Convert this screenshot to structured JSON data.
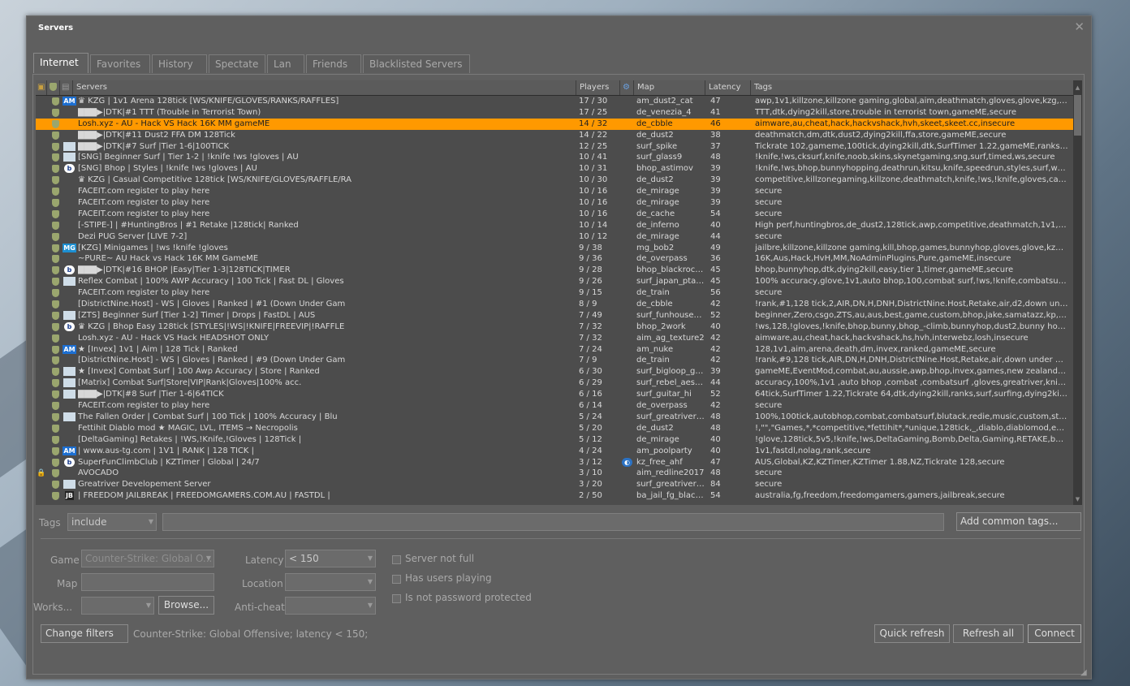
{
  "window": {
    "title": "Servers",
    "close_glyph": "✕"
  },
  "tabs": [
    "Internet",
    "Favorites",
    "History",
    "Spectate",
    "Lan",
    "Friends",
    "Blacklisted Servers"
  ],
  "columns": {
    "servers": "Servers",
    "players": "Players",
    "map": "Map",
    "latency": "Latency",
    "tags": "Tags"
  },
  "servers": [
    {
      "lock": "",
      "badge": "AM",
      "name": "♛ KZG | 1v1 Arena 128tick [WS/KNIFE/GLOVES/RANKS/RAFFLES]",
      "players": "17 / 30",
      "bot": "",
      "map": "am_dust2_cat",
      "latency": "47",
      "tags": "awp,1v1,killzone,killzone gaming,global,aim,deathmatch,gloves,glove,kzg,gungame,!..."
    },
    {
      "lock": "",
      "badge": "",
      "name": "▇▇▇▶|DTK|#1 TTT (Trouble in Terrorist Town)",
      "players": "17 / 25",
      "bot": "",
      "map": "de_venezia_4",
      "latency": "41",
      "tags": "TTT,dtk,dying2kill,store,trouble in terrorist town,gameME,secure"
    },
    {
      "lock": "",
      "badge": "",
      "name": "Losh.xyz - AU - Hack VS Hack 16K MM gameME",
      "players": "14 / 32",
      "bot": "",
      "map": "de_cbble",
      "latency": "46",
      "tags": "aimware,au,cheat,hack,hackvshack,hvh,skeet,skeet.cc,insecure",
      "selected": true
    },
    {
      "lock": "",
      "badge": "",
      "name": "▇▇▇▶|DTK|#11 Dust2 FFA DM 128Tick",
      "players": "14 / 22",
      "bot": "",
      "map": "de_dust2",
      "latency": "38",
      "tags": "deathmatch,dm,dtk,dust2,dying2kill,ffa,store,gameME,secure"
    },
    {
      "lock": "",
      "badge": "SQ",
      "name": "▇▇▇▶|DTK|#7 Surf |Tier 1-6|100TICK",
      "players": "12 / 25",
      "bot": "",
      "map": "surf_spike",
      "latency": "37",
      "tags": "Tickrate 102,gameme,100tick,dying2kill,dtk,SurfTimer 1.22,gameME,ranks,surf,surfing,..."
    },
    {
      "lock": "",
      "badge": "SQ",
      "name": "[SNG] Beginner Surf | Tier 1-2 | !knife !ws !gloves | AU",
      "players": "10 / 41",
      "bot": "",
      "map": "surf_glass9",
      "latency": "48",
      "tags": "!knife,!ws,cksurf,knife,noob,skins,skynetgaming,sng,surf,timed,ws,secure"
    },
    {
      "lock": "",
      "badge": "b",
      "name": "[SNG] Bhop | Styles | !knife !ws !gloves | AU",
      "players": "10 / 31",
      "bot": "",
      "map": "bhop_astimov",
      "latency": "39",
      "tags": "!knife,!ws,bhop,bunnyhopping,deathrun,kitsu,knife,speedrun,styles,surf,ws,secure"
    },
    {
      "lock": "",
      "badge": "",
      "name": "♛ KZG | Casual Competitive 128tick [WS/KNIFE/GLOVES/RAFFLE/RA",
      "players": "10 / 30",
      "bot": "",
      "map": "de_dust2",
      "latency": "39",
      "tags": "competitive,killzonegaming,killzone,deathmatch,knife,!ws,!knife,gloves,casual,kniv,glo..."
    },
    {
      "lock": "",
      "badge": "",
      "name": "FACEIT.com register to play here",
      "players": "10 / 16",
      "bot": "",
      "map": "de_mirage",
      "latency": "39",
      "tags": "secure"
    },
    {
      "lock": "",
      "badge": "",
      "name": "FACEIT.com register to play here",
      "players": "10 / 16",
      "bot": "",
      "map": "de_mirage",
      "latency": "39",
      "tags": "secure"
    },
    {
      "lock": "",
      "badge": "",
      "name": "FACEIT.com register to play here",
      "players": "10 / 16",
      "bot": "",
      "map": "de_cache",
      "latency": "54",
      "tags": "secure"
    },
    {
      "lock": "",
      "badge": "",
      "name": "[-STIPE-] | #HuntingBros | #1 Retake |128tick| Ranked",
      "players": "10 / 14",
      "bot": "",
      "map": "de_inferno",
      "latency": "40",
      "tags": "High perf,huntingbros,de_dust2,128tick,awp,competitive,deathmatch,1v1,minigames,j..."
    },
    {
      "lock": "",
      "badge": "",
      "name": "Dezi PUG Server [LIVE 7-2]",
      "players": "10 / 12",
      "bot": "",
      "map": "de_mirage",
      "latency": "44",
      "tags": "secure"
    },
    {
      "lock": "",
      "badge": "MG",
      "name": "[KZG] Minigames | !ws !knife !gloves",
      "players": "9 / 38",
      "bot": "",
      "map": "mg_bob2",
      "latency": "49",
      "tags": "jailbre,killzone,killzone gaming,kill,bhop,games,bunnyhop,gloves,glove,kzg,!ws,death..."
    },
    {
      "lock": "",
      "badge": "",
      "name": "~PURE~ AU Hack vs Hack 16K MM GameME",
      "players": "9 / 36",
      "bot": "",
      "map": "de_overpass",
      "latency": "36",
      "tags": "16K,Aus,Hack,HvH,MM,NoAdminPlugins,Pure,gameME,insecure"
    },
    {
      "lock": "",
      "badge": "b",
      "name": "▇▇▇▶|DTK|#16 BHOP |Easy|Tier 1-3|128TICK|TIMER",
      "players": "9 / 28",
      "bot": "",
      "map": "bhop_blackrock...",
      "latency": "45",
      "tags": "bhop,bunnyhop,dtk,dying2kill,easy,tier 1,timer,gameME,secure"
    },
    {
      "lock": "",
      "badge": "SQ",
      "name": "Reflex Combat | 100% AWP Accuracy | 100 Tick | Fast DL | Gloves",
      "players": "9 / 26",
      "bot": "",
      "map": "surf_japan_ptad...",
      "latency": "45",
      "tags": "100% accuracy,glove,1v1,auto bhop,100,combat surf,!ws,!knife,combatsurf,gloves,co..."
    },
    {
      "lock": "",
      "badge": "",
      "name": "FACEIT.com register to play here",
      "players": "9 / 15",
      "bot": "",
      "map": "de_train",
      "latency": "56",
      "tags": "secure"
    },
    {
      "lock": "",
      "badge": "",
      "name": "[DistrictNine.Host] - WS | Gloves | Ranked | #1 (Down Under Gam",
      "players": "8 / 9",
      "bot": "",
      "map": "de_cbble",
      "latency": "42",
      "tags": "!rank,#1,128 tick,2,AIR,DN,H,DNH,DistrictNine.Host,Retake,air,d2,down under gaming,..."
    },
    {
      "lock": "",
      "badge": "SQ",
      "name": "[ZTS] Beginner Surf [Tier 1-2] Timer | Drops | FastDL | AUS",
      "players": "7 / 49",
      "bot": "",
      "map": "surf_funhouse_njv",
      "latency": "52",
      "tags": "beginner,Zero,csgo,ZTS,au,aus,best,game,custom,bhop,jake,samatazz,kp,perth,rank..."
    },
    {
      "lock": "",
      "badge": "b",
      "name": "♛ KZG | Bhop Easy 128tick [STYLES|!WS|!KNIFE|FREEVIP|!RAFFLE",
      "players": "7 / 32",
      "bot": "",
      "map": "bhop_2work",
      "latency": "40",
      "tags": "!ws,128,!gloves,!knife,bhop,bunny,bhop_-climb,bunnyhop,dust2,bunny hop,gloves,k..."
    },
    {
      "lock": "",
      "badge": "",
      "name": "Losh.xyz - AU - Hack VS Hack HEADSHOT ONLY",
      "players": "7 / 32",
      "bot": "",
      "map": "aim_ag_texture2",
      "latency": "42",
      "tags": "aimware,au,cheat,hack,hackvshack,hs,hvh,interwebz,losh,insecure"
    },
    {
      "lock": "",
      "badge": "AM",
      "name": "★ [Invex] 1v1 | Aim | 128 Tick | Ranked",
      "players": "7 / 24",
      "bot": "",
      "map": "am_nuke",
      "latency": "42",
      "tags": "128,1v1,aim,arena,death,dm,invex,ranked,gameME,secure"
    },
    {
      "lock": "",
      "badge": "",
      "name": "[DistrictNine.Host] - WS | Gloves | Ranked | #9 (Down Under Gam",
      "players": "7 / 9",
      "bot": "",
      "map": "de_train",
      "latency": "42",
      "tags": "!rank,#9,128 tick,AIR,DN,H,DNH,DistrictNine.Host,Retake,air,down under gaming,dug..."
    },
    {
      "lock": "",
      "badge": "SQ",
      "name": "★ [Invex] Combat Surf | 100 Awp Accuracy | Store | Ranked",
      "players": "6 / 30",
      "bot": "",
      "map": "surf_bigloop_go...",
      "latency": "39",
      "tags": "gameME,EventMod,combat,au,aussie,awp,bhop,invex,games,new zealand,nz,rank,re..."
    },
    {
      "lock": "",
      "badge": "SQ",
      "name": "[Matrix] Combat Surf|Store|VIP|Rank|Gloves|100% acc.",
      "players": "6 / 29",
      "bot": "",
      "map": "surf_rebel_aesth...",
      "latency": "44",
      "tags": "accuracy,100%,1v1 ,auto bhop ,combat ,combatsurf ,gloves,greatriver,knife ,matrix ,..."
    },
    {
      "lock": "",
      "badge": "SQ",
      "name": "▇▇▇▶|DTK|#8 Surf |Tier 1-6|64TICK",
      "players": "6 / 16",
      "bot": "",
      "map": "surf_guitar_hi",
      "latency": "52",
      "tags": "64tick,SurfTimer 1.22,Tickrate 64,dtk,dying2kill,ranks,surf,surfing,dying2kill,tier 1,gameme,game..."
    },
    {
      "lock": "",
      "badge": "",
      "name": "FACEIT.com register to play here",
      "players": "6 / 14",
      "bot": "",
      "map": "de_overpass",
      "latency": "42",
      "tags": "secure"
    },
    {
      "lock": "",
      "badge": "SQ",
      "name": "The Fallen Order | Combat Surf | 100 Tick | 100% Accuracy | Blu",
      "players": "5 / 24",
      "bot": "",
      "map": "surf_greatriver_x...",
      "latency": "48",
      "tags": "100%,100tick,autobhop,combat,combatsurf,blutack,redie,music,custom,store,australia,..."
    },
    {
      "lock": "",
      "badge": "",
      "name": "Fettihit Diablo mod ★ MAGIC, LVL, ITEMS → Necropolis",
      "players": "5 / 20",
      "bot": "",
      "map": "de_dust2",
      "latency": "48",
      "tags": "!,\"\",\"Games,*,*competitive,*fettihit*,*unique,128tick,_,diablo,diablomod,en6*diablo,it..."
    },
    {
      "lock": "",
      "badge": "",
      "name": "[DeltaGaming] Retakes | !WS,!Knife,!Gloves | 128Tick |",
      "players": "5 / 12",
      "bot": "",
      "map": "de_mirage",
      "latency": "40",
      "tags": "!glove,128tick,5v5,!knife,!ws,DeltaGaming,Bomb,Delta,Gaming,RETAKE,bombsite,glov..."
    },
    {
      "lock": "",
      "badge": "AM",
      "name": "| www.aus-tg.com | 1V1 | RANK | 128 TICK |",
      "players": "4 / 24",
      "bot": "",
      "map": "am_poolparty",
      "latency": "40",
      "tags": "1v1,fastdl,nolag,rank,secure"
    },
    {
      "lock": "",
      "badge": "b",
      "name": "SuperFunClimbClub | KZTimer | Global | 24/7",
      "players": "3 / 12",
      "bot": "steam",
      "map": "kz_free_ahf",
      "latency": "47",
      "tags": "AUS,Global,KZ,KZTimer,KZTimer 1.88,NZ,Tickrate 128,secure"
    },
    {
      "lock": "🔒",
      "badge": "",
      "name": "AVOCADO",
      "players": "3 / 10",
      "bot": "",
      "map": "aim_redline2017",
      "latency": "48",
      "tags": "secure"
    },
    {
      "lock": "",
      "badge": "SQ",
      "name": "Greatriver Developement Server",
      "players": "3 / 20",
      "bot": "",
      "map": "surf_greatriver_...",
      "latency": "84",
      "tags": "secure"
    },
    {
      "lock": "",
      "badge": "JB",
      "name": "| FREEDOM JAILBREAK | FREEDOMGAMERS.COM.AU | FASTDL |",
      "players": "2 / 50",
      "bot": "",
      "map": "ba_jail_fg_black...",
      "latency": "54",
      "tags": "australia,fg,freedom,freedomgamers,gamers,jailbreak,secure"
    }
  ],
  "tags_bar": {
    "label": "Tags",
    "mode": "include",
    "input_value": "",
    "add_button": "Add common tags..."
  },
  "filters": {
    "game_label": "Game",
    "game_value": "Counter-Strike: Global O...",
    "map_label": "Map",
    "map_value": "",
    "workshop_label": "Works...",
    "workshop_value": "",
    "browse_button": "Browse...",
    "latency_label": "Latency",
    "latency_value": "< 150",
    "location_label": "Location",
    "location_value": "",
    "anticheat_label": "Anti-cheat",
    "anticheat_value": "",
    "check_not_full": "Server not full",
    "check_users_playing": "Has users playing",
    "check_not_password": "Is not password protected"
  },
  "bottom": {
    "change_filters": "Change filters",
    "summary": "Counter-Strike: Global Offensive; latency < 150;",
    "quick_refresh": "Quick refresh",
    "refresh_all": "Refresh all",
    "connect": "Connect"
  }
}
